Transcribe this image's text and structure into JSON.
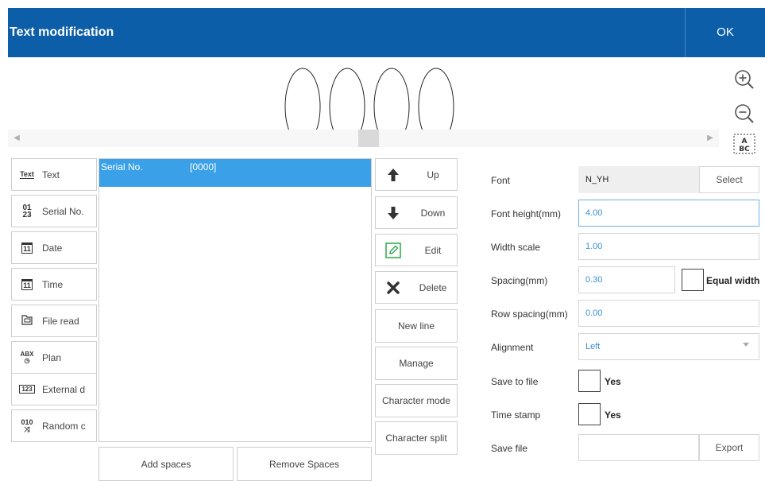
{
  "header": {
    "title": "Text modification",
    "ok_label": "OK"
  },
  "preview": {
    "text": "0000"
  },
  "types": [
    {
      "icon": "Text",
      "label": "Text"
    },
    {
      "icon": "01/23",
      "label": "Serial No."
    },
    {
      "icon": "11",
      "label": "Date"
    },
    {
      "icon": "11",
      "label": "Time"
    },
    {
      "icon": "file",
      "label": "File read"
    },
    {
      "icon": "ABX",
      "label": "Plan"
    },
    {
      "icon": "123",
      "label": "External d"
    },
    {
      "icon": "010",
      "label": "Random c"
    }
  ],
  "list": {
    "rows": [
      {
        "name": "Serial No.",
        "value": "[0000]"
      }
    ]
  },
  "bottom": {
    "add_spaces": "Add spaces",
    "remove_spaces": "Remove Spaces"
  },
  "actions": {
    "up": "Up",
    "down": "Down",
    "edit": "Edit",
    "delete": "Delete",
    "new_line": "New line",
    "manage": "Manage",
    "character_mode": "Character mode",
    "character_split": "Character split"
  },
  "props": {
    "font": {
      "label": "Font",
      "value": "N_YH",
      "button": "Select"
    },
    "font_height": {
      "label": "Font height(mm)",
      "value": "4.00"
    },
    "width_scale": {
      "label": "Width scale",
      "value": "1.00"
    },
    "spacing": {
      "label": "Spacing(mm)",
      "value": "0.30",
      "equal_width": "Equal width"
    },
    "row_spacing": {
      "label": "Row spacing(mm)",
      "value": "0.00"
    },
    "alignment": {
      "label": "Alignment",
      "value": "Left"
    },
    "save_to_file": {
      "label": "Save to file",
      "option": "Yes"
    },
    "time_stamp": {
      "label": "Time stamp",
      "option": "Yes"
    },
    "save_file": {
      "label": "Save file",
      "value": "",
      "button": "Export"
    }
  },
  "colors": {
    "header": "#0d5ea8",
    "selection": "#3aa0e8",
    "value_text": "#3a8fd6"
  }
}
